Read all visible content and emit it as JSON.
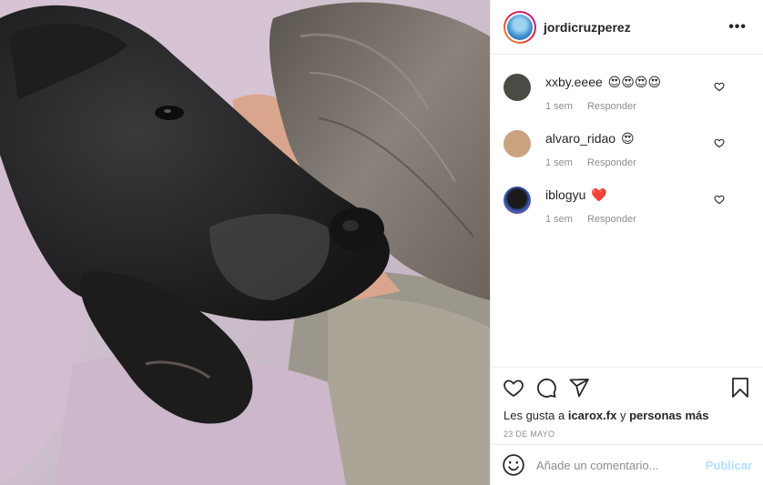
{
  "post": {
    "username": "jordicruzperez",
    "more_label": "•••"
  },
  "comments": [
    {
      "user": "xxby.eeee",
      "text": "😍😍😍😍",
      "time": "1 sem",
      "reply": "Responder",
      "avatar_color": "#4b4a44"
    },
    {
      "user": "alvaro_ridao",
      "text": "😍",
      "time": "1 sem",
      "reply": "Responder",
      "avatar_color": "#c9a37f"
    },
    {
      "user": "iblogyu",
      "text": "❤️",
      "time": "1 sem",
      "reply": "Responder",
      "avatar_color": "#1a2b5c"
    }
  ],
  "likes": {
    "prefix": "Les gusta a",
    "user": "icarox.fx",
    "joiner": "y",
    "others": "personas más"
  },
  "date": "23 DE MAYO",
  "add_comment": {
    "placeholder": "Añade un comentario...",
    "publish": "Publicar"
  },
  "icons": {
    "like": "heart-icon",
    "comment": "comment-icon",
    "share": "paper-plane-icon",
    "save": "bookmark-icon",
    "emoji": "smiley-icon"
  }
}
